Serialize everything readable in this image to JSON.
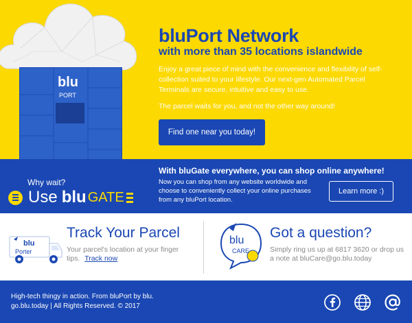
{
  "hero": {
    "title": "bluPort Network",
    "subtitle": "with more than 35 locations islandwide",
    "paragraph": "Enjoy a great piece of mind with the convenience and flexibility of self-collection suited to your lifestyle. Our next-gen Automated Parcel Terminals are secure, intuitive and easy to use.",
    "tagline": "The parcel waits for you, and not the other way around!",
    "cta_label": "Find one near you today!",
    "locker_brand": "blu",
    "locker_sub": "PORT"
  },
  "gate": {
    "why_wait": "Why wait?",
    "use": "Use",
    "blu": "blu",
    "gate": "GATE",
    "heading": "With bluGate everywhere, you can shop online anywhere!",
    "paragraph": "Now you can shop from any website worldwide and choose to conveniently collect your online purchases from any bluPort location.",
    "learn_label": "Learn more :)"
  },
  "track": {
    "title": "Track Your Parcel",
    "text": "Your parcel's location at your finger tips.",
    "link_label": "Track now",
    "logo_blu": "blu",
    "logo_sub": "Porter"
  },
  "question": {
    "title": "Got a question?",
    "text": "Simply ring us up at 6817 3620 or drop us a note at bluCare@go.blu.today",
    "logo_blu": "blu",
    "logo_sub": "CARE"
  },
  "footer": {
    "line1": "High-tech thingy in action. From bluPort by blu.",
    "line2": "go.blu.today  |  All Rights Reserved.  © 2017",
    "icons": [
      "facebook-icon",
      "globe-icon",
      "at-icon"
    ]
  },
  "colors": {
    "brand_blue": "#1a47b3",
    "brand_yellow": "#fcd900"
  }
}
